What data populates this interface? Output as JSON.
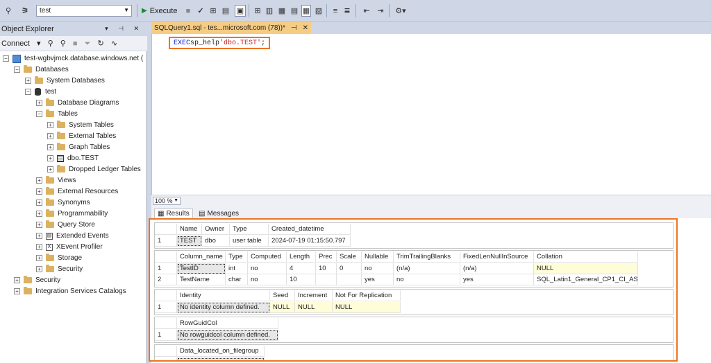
{
  "toolbar": {
    "database": "test",
    "execute_label": "Execute"
  },
  "object_explorer": {
    "title": "Object Explorer",
    "connect_label": "Connect",
    "tree": {
      "server": "test-wgbvjmck.database.windows.net (",
      "databases": "Databases",
      "system_databases": "System Databases",
      "test_db": "test",
      "database_diagrams": "Database Diagrams",
      "tables": "Tables",
      "system_tables": "System Tables",
      "external_tables": "External Tables",
      "graph_tables": "Graph Tables",
      "dbo_test": "dbo.TEST",
      "dropped_ledger_tables": "Dropped Ledger Tables",
      "views": "Views",
      "external_resources": "External Resources",
      "synonyms": "Synonyms",
      "programmability": "Programmability",
      "query_store": "Query Store",
      "extended_events": "Extended Events",
      "xevent_profiler": "XEvent Profiler",
      "storage": "Storage",
      "security_db": "Security",
      "security_server": "Security",
      "integration_services": "Integration Services Catalogs"
    }
  },
  "editor": {
    "tab_title": "SQLQuery1.sql - tes...microsoft.com (78))*",
    "sql_keyword": "EXEC",
    "sql_proc": "sp_help",
    "sql_string": "'dbo.TEST'",
    "sql_end": ";"
  },
  "zoom": "100 %",
  "result_tabs": {
    "results": "Results",
    "messages": "Messages"
  },
  "results": {
    "grid1": {
      "headers": [
        "Name",
        "Owner",
        "Type",
        "Created_datetime"
      ],
      "rows": [
        [
          "1",
          "TEST",
          "dbo",
          "user table",
          "2024-07-19 01:15:50.797"
        ]
      ]
    },
    "grid2": {
      "headers": [
        "Column_name",
        "Type",
        "Computed",
        "Length",
        "Prec",
        "Scale",
        "Nullable",
        "TrimTrailingBlanks",
        "FixedLenNullInSource",
        "Collation"
      ],
      "rows": [
        [
          "1",
          "TestID",
          "int",
          "no",
          "4",
          "10",
          "0",
          "no",
          "(n/a)",
          "(n/a)",
          "NULL"
        ],
        [
          "2",
          "TestName",
          "char",
          "no",
          "10",
          "",
          "",
          "yes",
          "no",
          "yes",
          "SQL_Latin1_General_CP1_CI_AS"
        ]
      ]
    },
    "grid3": {
      "headers": [
        "Identity",
        "Seed",
        "Increment",
        "Not For Replication"
      ],
      "rows": [
        [
          "1",
          "No identity column defined.",
          "NULL",
          "NULL",
          "NULL"
        ]
      ]
    },
    "grid4": {
      "headers": [
        "RowGuidCol"
      ],
      "rows": [
        [
          "1",
          "No rowguidcol column defined."
        ]
      ]
    },
    "grid5": {
      "headers": [
        "Data_located_on_filegroup"
      ]
    }
  }
}
